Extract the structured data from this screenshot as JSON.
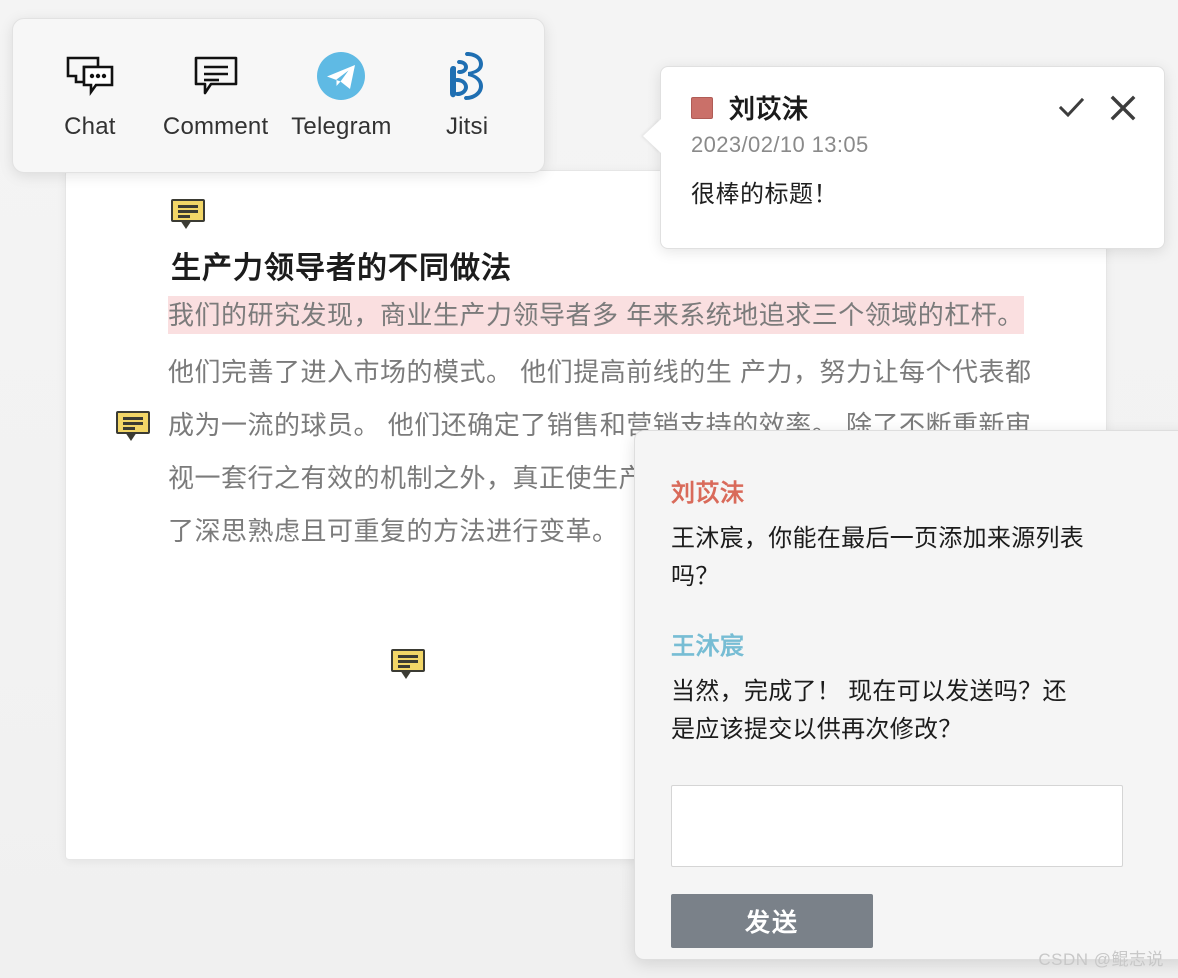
{
  "toolbar": {
    "items": [
      {
        "label": "Chat",
        "icon": "chat-bubbles-icon"
      },
      {
        "label": "Comment",
        "icon": "comment-bubble-icon"
      },
      {
        "label": "Telegram",
        "icon": "telegram-icon"
      },
      {
        "label": "Jitsi",
        "icon": "jitsi-icon"
      }
    ]
  },
  "document": {
    "title": "生产力领导者的不同做法",
    "highlight_paragraph": "我们的研究发现，商业生产力领导者多 年来系统地追求三个领域的杠杆。",
    "body_paragraph": "他们完善了进入市场的模式。 他们提高前线的生 产力，努力让每个代表都成为一流的球员。 他们还确定了销售和营销支持的效率。 除了不断重新审视一套行之有效的机制之外，真正使生产力领导者与众不同的是，他们采取了深思熟虑且可重复的方法进行变革。",
    "markers": [
      {
        "name": "comment-marker-title",
        "icon": "comment-bubble-icon"
      },
      {
        "name": "comment-marker-paragraph",
        "icon": "comment-bubble-icon"
      },
      {
        "name": "comment-marker-inline",
        "icon": "comment-bubble-icon"
      }
    ]
  },
  "comment_popup": {
    "author": "刘苡沫",
    "author_color": "#ca7069",
    "timestamp": "2023/02/10 13:05",
    "text": "很棒的标题！",
    "resolve_icon": "check-icon",
    "close_icon": "close-icon"
  },
  "chat_panel": {
    "messages": [
      {
        "author": "刘苡沫",
        "color": "#d96a5a",
        "text": "王沐宸，你能在最后一页添加来源列表吗？"
      },
      {
        "author": "王沐宸",
        "color": "#77bdd4",
        "text": "当然，完成了！ 现在可以发送吗？还是应该提交以供再次修改？"
      }
    ],
    "input_value": "",
    "input_placeholder": "",
    "send_label": "发送",
    "send_color": "#7a8189"
  },
  "watermark": "CSDN @鲲志说"
}
